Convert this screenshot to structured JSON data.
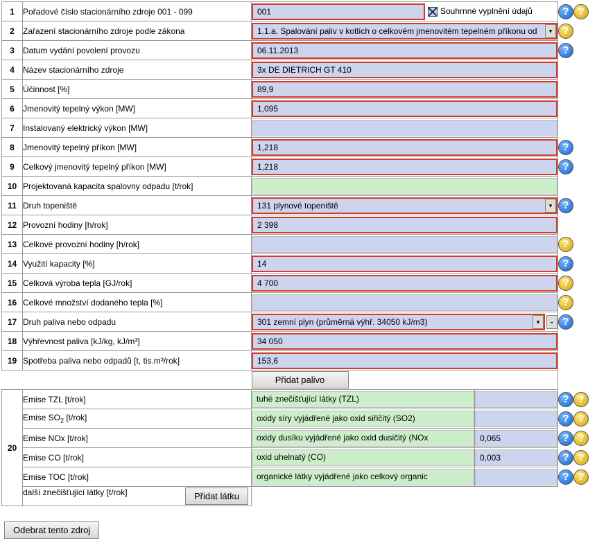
{
  "rows": {
    "r1": {
      "n": "1",
      "label": "Pořadové číslo stacionárního zdroje      001 - 099",
      "value": "001",
      "chk_label": "Souhrnné vyplnění údajů"
    },
    "r2": {
      "n": "2",
      "label": "Zařazení stacionárního zdroje podle zákona",
      "value": "1.1.a.  Spalování paliv v kotlích o celkovém jmenovitém tepelném příkonu od"
    },
    "r3": {
      "n": "3",
      "label": "Datum vydání povolení provozu",
      "value": "06.11.2013"
    },
    "r4": {
      "n": "4",
      "label": "Název stacionárního zdroje",
      "value": "3x DE DIETRICH GT 410"
    },
    "r5": {
      "n": "5",
      "label": "Účinnost          [%]",
      "value": "89,9"
    },
    "r6": {
      "n": "6",
      "label": "Jmenovitý tepelný výkon     [MW]",
      "value": "1,095"
    },
    "r7": {
      "n": "7",
      "label": "Instalovaný elektrický výkon     [MW]",
      "value": ""
    },
    "r8": {
      "n": "8",
      "label": "Jmenovitý tepelný příkon     [MW]",
      "value": "1,218"
    },
    "r9": {
      "n": "9",
      "label": "Celkový jmenovitý tepelný příkon     [MW]",
      "value": "1,218"
    },
    "r10": {
      "n": "10",
      "label": "Projektovaná kapacita spalovny odpadu [t/rok]",
      "value": ""
    },
    "r11": {
      "n": "11",
      "label": "Druh topeniště",
      "value": "131  plynové topeniště"
    },
    "r12": {
      "n": "12",
      "label": "Provozní hodiny       [h/rok]",
      "value": "2 398"
    },
    "r13": {
      "n": "13",
      "label": "Celkové provozní hodiny       [h/rok]",
      "value": ""
    },
    "r14": {
      "n": "14",
      "label": "Využití kapacity       [%]",
      "value": "14"
    },
    "r15": {
      "n": "15",
      "label": "Celková výroba tepla       [GJ/rok]",
      "value": "4 700"
    },
    "r16": {
      "n": "16",
      "label": "Celkové množství dodaného tepla       [%]",
      "value": ""
    },
    "r17": {
      "n": "17",
      "label": "Druh paliva nebo odpadu",
      "value": "301  zemní plyn (průměrná výhř. 34050 kJ/m3)"
    },
    "r18": {
      "n": "18",
      "label": "Výhřevnost paliva       [kJ/kg, kJ/m³]",
      "value": "34 050"
    },
    "r19": {
      "n": "19",
      "label": "Spotřeba paliva nebo odpadů       [t, tis.m³/rok]",
      "value": "153,6"
    }
  },
  "buttons": {
    "add_fuel": "Přidat palivo",
    "add_substance": "Přidat látku",
    "remove_source": "Odebrat tento zdroj"
  },
  "emise": {
    "n": "20",
    "tzl": {
      "label": "Emise  TZL    [t/rok]",
      "desc": "tuhé znečišťující látky (TZL)",
      "val": ""
    },
    "so2": {
      "label_pre": "Emise  SO",
      "label_suf": "    [t/rok]",
      "sub": "2",
      "desc": "oxidy síry vyjádřené jako oxid siřičitý (SO2)",
      "val": ""
    },
    "nox": {
      "label": "Emise  NOx    [t/rok]",
      "desc": "oxidy dusíku vyjádřené jako oxid dusičitý (NOx",
      "val": "0,065"
    },
    "co": {
      "label": "Emise  CO    [t/rok]",
      "desc": "oxid uhelnatý (CO)",
      "val": "0,003"
    },
    "toc": {
      "label": "Emise  TOC    [t/rok]",
      "desc": "organické látky vyjádřené jako celkový organic",
      "val": ""
    },
    "other": {
      "label": "další znečišťující látky    [t/rok]"
    }
  },
  "glyph": {
    "q": "?",
    "dash": "-",
    "tri": "▾"
  }
}
